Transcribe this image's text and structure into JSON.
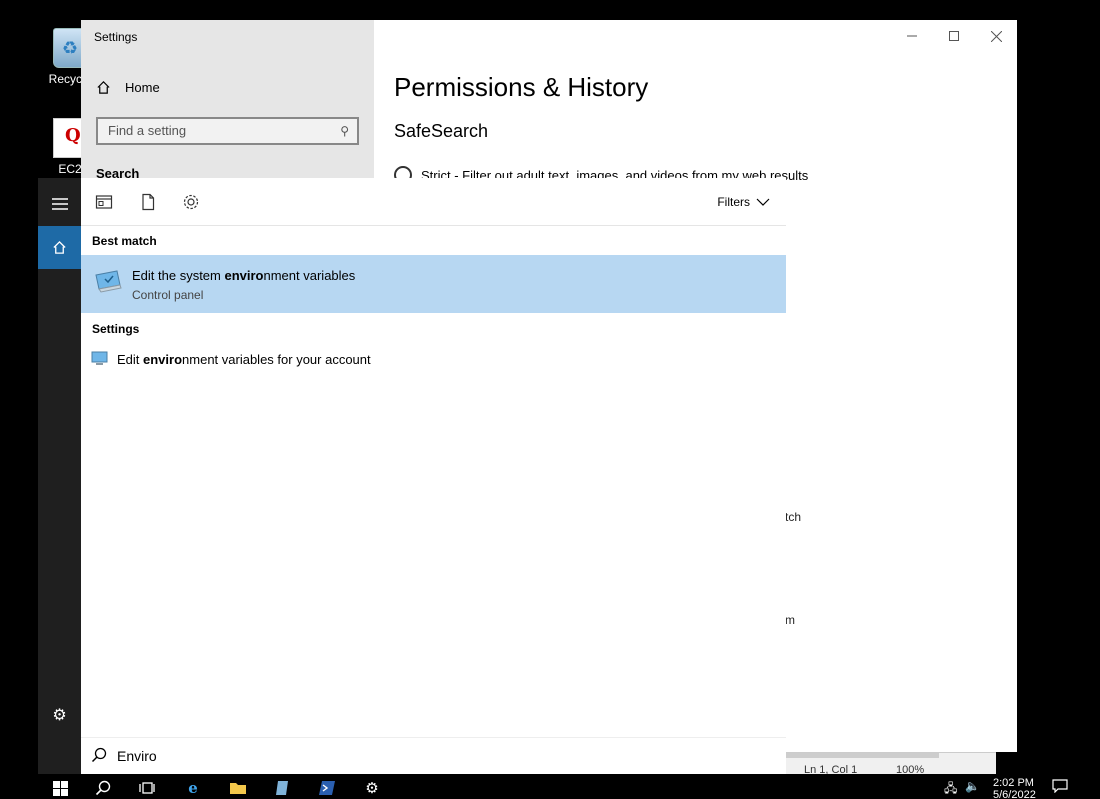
{
  "desktop": {
    "icons": [
      {
        "label": "Recycle"
      },
      {
        "label": "EC2"
      }
    ]
  },
  "settings_window": {
    "title": "Settings",
    "home_label": "Home",
    "find_placeholder": "Find a setting",
    "search_category": "Search",
    "page_title": "Permissions & History",
    "safesearch_heading": "SafeSearch",
    "strict_option": "Strict - Filter out adult text, images, and videos from my web results",
    "peek_text_1": "tch",
    "peek_text_2": "m"
  },
  "notepad": {
    "position": "Ln 1, Col 1",
    "zoom": "100%"
  },
  "start_search": {
    "filters_label": "Filters",
    "best_match_label": "Best match",
    "best_match": {
      "title_prefix": "Edit the system ",
      "title_match": "enviro",
      "title_suffix": "nment variables",
      "subtitle": "Control panel"
    },
    "settings_label": "Settings",
    "settings_result": {
      "prefix": "Edit ",
      "match": "enviro",
      "suffix": "nment variables for your account"
    },
    "query": "Enviro"
  },
  "taskbar": {
    "time": "2:02 PM",
    "date": "5/6/2022"
  },
  "colors": {
    "selection": "#b7d7f2",
    "accent": "#1e6aa6",
    "rail": "#1f1f1f"
  }
}
